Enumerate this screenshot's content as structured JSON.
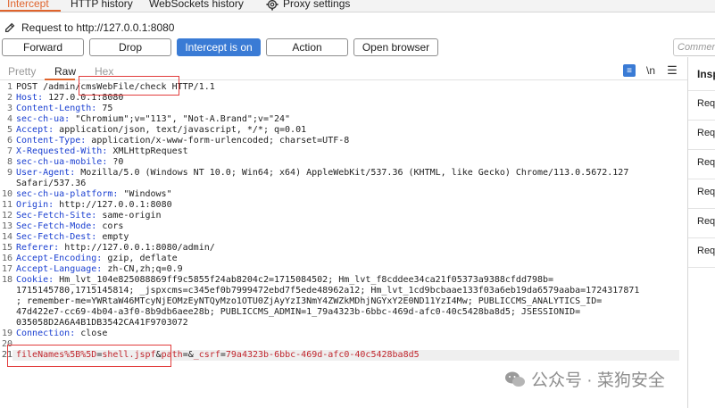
{
  "tabs": [
    {
      "label": "Intercept",
      "active": true
    },
    {
      "label": "HTTP history",
      "active": false
    },
    {
      "label": "WebSockets history",
      "active": false
    },
    {
      "label": "Proxy settings",
      "active": false
    }
  ],
  "request_line": "Request to http://127.0.0.1:8080",
  "buttons": {
    "forward": "Forward",
    "drop": "Drop",
    "intercept": "Intercept is on",
    "action": "Action",
    "open_browser": "Open browser",
    "comment_placeholder": "Commen"
  },
  "editor_tabs": [
    "Pretty",
    "Raw",
    "Hex"
  ],
  "editor_active_tab": "Raw",
  "toolbar_icons": [
    "wrap-icon",
    "newline-icon",
    "menu-icon"
  ],
  "inspector": {
    "title": "Insp",
    "rows": [
      "Req",
      "Req",
      "Req",
      "Req",
      "Req",
      "Req"
    ]
  },
  "lines": [
    {
      "n": "1",
      "k": "",
      "v": "POST /admin/cmsWebFile/check HTTP/1.1"
    },
    {
      "n": "2",
      "k": "Host:",
      "v": " 127.0.0.1:8080"
    },
    {
      "n": "3",
      "k": "Content-Length:",
      "v": " 75"
    },
    {
      "n": "4",
      "k": "sec-ch-ua:",
      "v": " \"Chromium\";v=\"113\", \"Not-A.Brand\";v=\"24\""
    },
    {
      "n": "5",
      "k": "Accept:",
      "v": " application/json, text/javascript, */*; q=0.01"
    },
    {
      "n": "6",
      "k": "Content-Type:",
      "v": " application/x-www-form-urlencoded; charset=UTF-8"
    },
    {
      "n": "7",
      "k": "X-Requested-With:",
      "v": " XMLHttpRequest"
    },
    {
      "n": "8",
      "k": "sec-ch-ua-mobile:",
      "v": " ?0"
    },
    {
      "n": "9",
      "k": "User-Agent:",
      "v": " Mozilla/5.0 (Windows NT 10.0; Win64; x64) AppleWebKit/537.36 (KHTML, like Gecko) Chrome/113.0.5672.127"
    },
    {
      "n": "",
      "k": "",
      "v": "Safari/537.36"
    },
    {
      "n": "10",
      "k": "sec-ch-ua-platform:",
      "v": " \"Windows\""
    },
    {
      "n": "11",
      "k": "Origin:",
      "v": " http://127.0.0.1:8080"
    },
    {
      "n": "12",
      "k": "Sec-Fetch-Site:",
      "v": " same-origin"
    },
    {
      "n": "13",
      "k": "Sec-Fetch-Mode:",
      "v": " cors"
    },
    {
      "n": "14",
      "k": "Sec-Fetch-Dest:",
      "v": " empty"
    },
    {
      "n": "15",
      "k": "Referer:",
      "v": " http://127.0.0.1:8080/admin/"
    },
    {
      "n": "16",
      "k": "Accept-Encoding:",
      "v": " gzip, deflate"
    },
    {
      "n": "17",
      "k": "Accept-Language:",
      "v": " zh-CN,zh;q=0.9"
    },
    {
      "n": "18",
      "k": "Cookie:",
      "v": " Hm_lvt_104e825088869ff9c5855f24ab8204c2=1715084502; Hm_lvt_f8cddee34ca21f05373a9388cfdd798b="
    },
    {
      "n": "",
      "k": "",
      "v": "1715145780,1715145814; _jspxcms=c345ef0b7999472ebd7f5ede48962a12; Hm_lvt_1cd9bcbaae133f03a6eb19da6579aaba=1724317871"
    },
    {
      "n": "",
      "k": "",
      "v": "; remember-me=YWRtaW46MTcyNjEOMzEyNTQyMzo1OTU0ZjAyYzI3NmY4ZWZkMDhjNGYxY2E0ND11YzI4Mw; PUBLICCMS_ANALYTICS_ID="
    },
    {
      "n": "",
      "k": "",
      "v": "47d422e7-cc69-4b04-a3f0-8b9db6aee28b; PUBLICCMS_ADMIN=1_79a4323b-6bbc-469d-afc0-40c5428ba8d5; JSESSIONID="
    },
    {
      "n": "",
      "k": "",
      "v": "035058D2A6A4B1DB3542CA41F9703072"
    },
    {
      "n": "19",
      "k": "Connection:",
      "v": " close"
    },
    {
      "n": "20",
      "k": "",
      "v": ""
    },
    {
      "n": "21",
      "k": "",
      "v": ""
    }
  ],
  "body_line": {
    "p1": "fileNames%5B%5D",
    "eq1": "=",
    "v1": "shell.jspf",
    "amp1": "&",
    "p2": "path",
    "eq2": "=",
    "amp2": "&",
    "p3": "_csrf",
    "eq3": "=",
    "v3": "79a4323b-6bbc-469d-afc0-40c5428ba8d5"
  },
  "watermark": "公众号 · 菜狗安全"
}
